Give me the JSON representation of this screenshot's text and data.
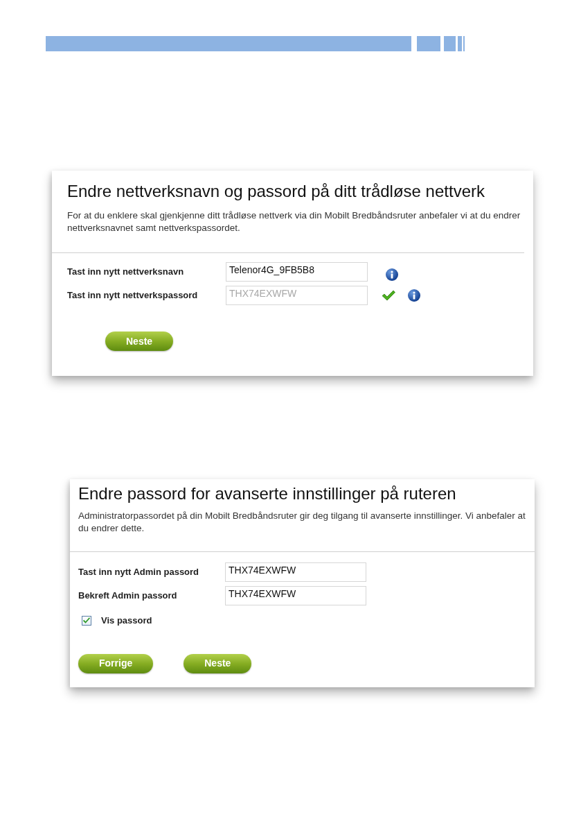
{
  "panels": [
    {
      "title": "Endre nettverksnavn og passord på ditt trådløse nettverk",
      "description": "For at du enklere skal gjenkjenne ditt trådløse nettverk via din Mobilt Bredbåndsruter anbefaler vi at du endrer nettverksnavnet samt nettverkspassordet.",
      "fields": [
        {
          "label": "Tast inn nytt nettverksnavn",
          "value": "Telenor4G_9FB5B8",
          "valid": false,
          "info": true
        },
        {
          "label": "Tast inn nytt nettverkspassord",
          "placeholder": "THX74EXWFW",
          "valid": true,
          "info": true
        }
      ],
      "buttons": [
        "Neste"
      ]
    },
    {
      "title": "Endre passord for avanserte innstillinger på ruteren",
      "description": "Administratorpassordet på din Mobilt Bredbåndsruter gir deg tilgang til avanserte innstillinger. Vi anbefaler at du endrer dette.",
      "fields": [
        {
          "label": "Tast inn nytt Admin passord",
          "value": "THX74EXWFW",
          "valid": false,
          "info": false
        },
        {
          "label": "Bekreft Admin passord",
          "value": "THX74EXWFW",
          "valid": false,
          "info": false
        }
      ],
      "checkbox": {
        "label": "Vis passord",
        "checked": true
      },
      "buttons": [
        "Forrige",
        "Neste"
      ]
    }
  ]
}
